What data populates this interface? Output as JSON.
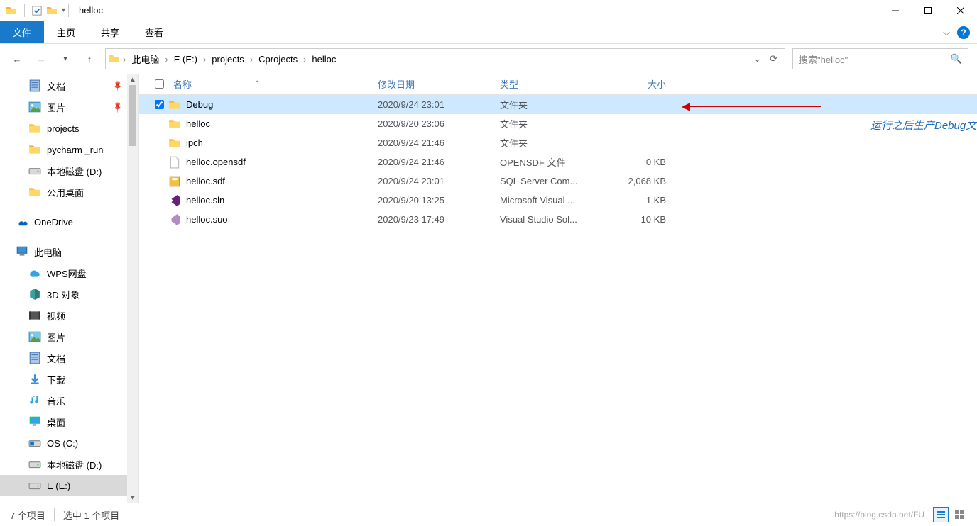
{
  "titlebar": {
    "title": "helloc"
  },
  "ribbon": {
    "file": "文件",
    "home": "主页",
    "share": "共享",
    "view": "查看"
  },
  "breadcrumb": [
    "此电脑",
    "E (E:)",
    "projects",
    "Cprojects",
    "helloc"
  ],
  "search": {
    "placeholder": "搜索\"helloc\""
  },
  "sidebar": {
    "items": [
      {
        "label": "文档",
        "icon": "doc",
        "pin": true
      },
      {
        "label": "图片",
        "icon": "pic",
        "pin": true
      },
      {
        "label": "projects",
        "icon": "folder",
        "pin": false
      },
      {
        "label": "pycharm _run",
        "icon": "folder",
        "pin": false
      },
      {
        "label": "本地磁盘 (D:)",
        "icon": "disk",
        "pin": false
      },
      {
        "label": "公用桌面",
        "icon": "folder",
        "pin": false
      }
    ],
    "onedrive": "OneDrive",
    "thispc": "此电脑",
    "pc_children": [
      {
        "label": "WPS网盘",
        "icon": "wps"
      },
      {
        "label": "3D 对象",
        "icon": "3d"
      },
      {
        "label": "视频",
        "icon": "video"
      },
      {
        "label": "图片",
        "icon": "pic"
      },
      {
        "label": "文档",
        "icon": "doc"
      },
      {
        "label": "下载",
        "icon": "down"
      },
      {
        "label": "音乐",
        "icon": "music"
      },
      {
        "label": "桌面",
        "icon": "desktop"
      },
      {
        "label": "OS (C:)",
        "icon": "osdisk"
      },
      {
        "label": "本地磁盘 (D:)",
        "icon": "disk"
      },
      {
        "label": "E (E:)",
        "icon": "disk",
        "selected": true
      }
    ]
  },
  "columns": {
    "name": "名称",
    "date": "修改日期",
    "type": "类型",
    "size": "大小"
  },
  "rows": [
    {
      "name": "Debug",
      "date": "2020/9/24 23:01",
      "type": "文件夹",
      "size": "",
      "icon": "folder",
      "selected": true,
      "checked": true
    },
    {
      "name": "helloc",
      "date": "2020/9/20 23:06",
      "type": "文件夹",
      "size": "",
      "icon": "folder"
    },
    {
      "name": "ipch",
      "date": "2020/9/24 21:46",
      "type": "文件夹",
      "size": "",
      "icon": "folder"
    },
    {
      "name": "helloc.opensdf",
      "date": "2020/9/24 21:46",
      "type": "OPENSDF 文件",
      "size": "0 KB",
      "icon": "file"
    },
    {
      "name": "helloc.sdf",
      "date": "2020/9/24 23:01",
      "type": "SQL Server Com...",
      "size": "2,068 KB",
      "icon": "sdf"
    },
    {
      "name": "helloc.sln",
      "date": "2020/9/20 13:25",
      "type": "Microsoft Visual ...",
      "size": "1 KB",
      "icon": "sln"
    },
    {
      "name": "helloc.suo",
      "date": "2020/9/23 17:49",
      "type": "Visual Studio Sol...",
      "size": "10 KB",
      "icon": "suo"
    }
  ],
  "annotation": "运行之后生产Debug文件",
  "status": {
    "count": "7 个项目",
    "selected": "选中 1 个项目",
    "watermark": "https://blog.csdn.net/FU"
  }
}
